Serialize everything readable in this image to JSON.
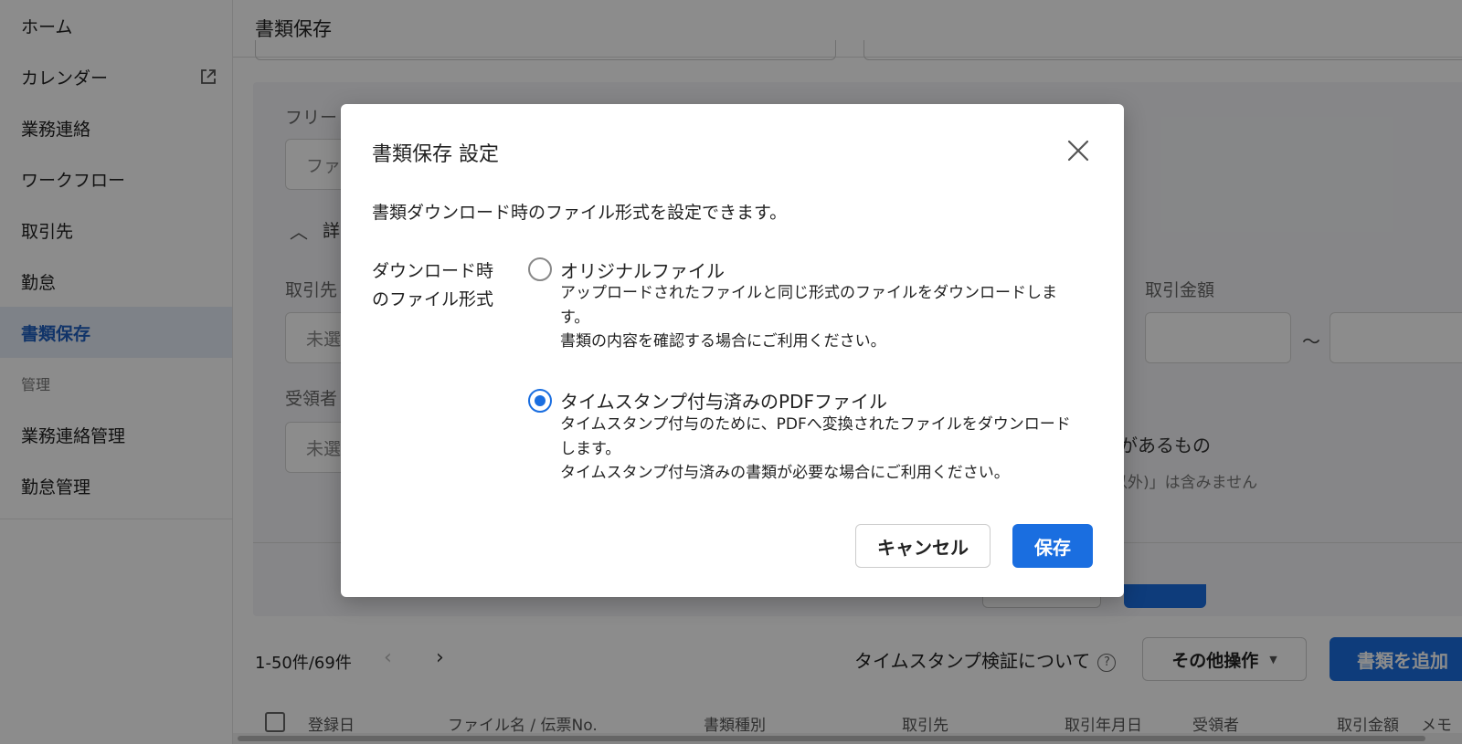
{
  "sidebar": {
    "items": [
      {
        "label": "ホーム"
      },
      {
        "label": "カレンダー",
        "icon": "external-link-icon"
      },
      {
        "label": "業務連絡"
      },
      {
        "label": "ワークフロー"
      },
      {
        "label": "取引先"
      },
      {
        "label": "勤怠"
      },
      {
        "label": "書類保存",
        "active": true
      }
    ],
    "section_label": "管理",
    "admin_items": [
      {
        "label": "業務連絡管理"
      },
      {
        "label": "勤怠管理"
      }
    ]
  },
  "header": {
    "title": "書類保存"
  },
  "filters": {
    "freeword_label": "フリー",
    "freeword_placeholder": "ファ",
    "detail_toggle_label": "詳",
    "partner_label": "取引先",
    "partner_value": "未選",
    "receiver_label": "受領者",
    "receiver_value": "未選",
    "amount_label": "取引金額",
    "amount_separator": "〜",
    "note_text": "があるもの",
    "note_sub": "以外)」は含みません"
  },
  "toolbar": {
    "count": "1-50件/69件",
    "timestamp_link": "タイムスタンプ検証について",
    "other_actions": "その他操作",
    "add_document": "書類を追加"
  },
  "table": {
    "headers": [
      "登録日",
      "ファイル名 / 伝票No.",
      "書類種別",
      "取引先",
      "取引年月日",
      "受領者",
      "取引金額",
      "メモ"
    ]
  },
  "modal": {
    "title": "書類保存 設定",
    "description": "書類ダウンロード時のファイル形式を設定できます。",
    "option_label_line1": "ダウンロード時",
    "option_label_line2": "のファイル形式",
    "options": [
      {
        "title": "オリジナルファイル",
        "desc_line1": "アップロードされたファイルと同じ形式のファイルをダウンロードしま",
        "desc_line2": "す。",
        "desc_line3": "書類の内容を確認する場合にご利用ください。",
        "selected": false
      },
      {
        "title": "タイムスタンプ付与済みのPDFファイル",
        "desc_line1": "タイムスタンプ付与のために、PDFへ変換されたファイルをダウンロード",
        "desc_line2": "します。",
        "desc_line3": "タイムスタンプ付与済みの書類が必要な場合にご利用ください。",
        "selected": true
      }
    ],
    "cancel_label": "キャンセル",
    "save_label": "保存"
  },
  "colors": {
    "accent": "#1a6ee0",
    "sidebar_active_bg": "#e6edf8"
  }
}
